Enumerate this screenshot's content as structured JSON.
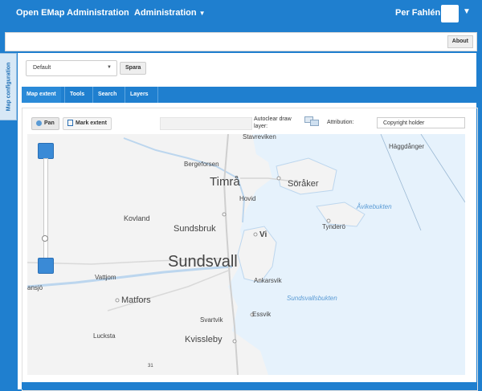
{
  "header": {
    "brand": "Open EMap Administration",
    "admin_menu": "Administration",
    "user_name": "Per Fahlén"
  },
  "about_button": "About",
  "side_tab": "Map configuration",
  "config": {
    "preset_value": "Default",
    "save_label": "Spara"
  },
  "tabs": [
    {
      "label": "Map extent"
    },
    {
      "label": "Tools"
    },
    {
      "label": "Search"
    },
    {
      "label": "Layers"
    }
  ],
  "toolbar": {
    "pan_label": "Pan",
    "mark_label": "Mark extent",
    "autoclear_label": "Autoclear draw layer:",
    "attribution_label": "Attribution:",
    "attribution_value": "Copyright holder"
  },
  "map": {
    "labels": [
      {
        "text": "Stavreviken"
      },
      {
        "text": "Häggdånger"
      },
      {
        "text": "Bergeforsen"
      },
      {
        "text": "Timrå"
      },
      {
        "text": "Söråker"
      },
      {
        "text": "Hovid"
      },
      {
        "text": "Åvikebukten"
      },
      {
        "text": "Kovland"
      },
      {
        "text": "Tynderö"
      },
      {
        "text": "Sundsbruk"
      },
      {
        "text": "Vi"
      },
      {
        "text": "Sundsvall"
      },
      {
        "text": "Vattjom"
      },
      {
        "text": "ansjö"
      },
      {
        "text": "Ankarsvik"
      },
      {
        "text": "Sundsvallsbukten"
      },
      {
        "text": "Matfors"
      },
      {
        "text": "Essvik"
      },
      {
        "text": "Svartvik"
      },
      {
        "text": "Lucksta"
      },
      {
        "text": "Kvissleby"
      },
      {
        "text": "31"
      }
    ]
  },
  "colors": {
    "brand_blue": "#1f7fcf",
    "water": "#e6f2fc",
    "land": "#f3f3f3"
  }
}
